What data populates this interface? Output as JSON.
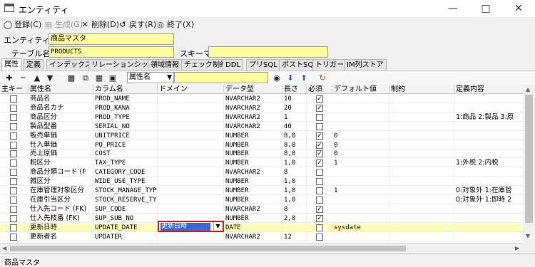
{
  "window": {
    "title": "エンティティ"
  },
  "toolbar": {
    "register": "登録(C)",
    "generate": "生成(G)",
    "delete": "削除(D)",
    "back": "戻す(R)",
    "exit": "終了(X)"
  },
  "entity": {
    "name_label": "エンティティ名",
    "name_value": "商品マスタ",
    "table_label": "テーブル名",
    "table_value": "PRODUCTS",
    "schema_label": "スキーマ",
    "schema_value": ""
  },
  "tabs": [
    "属性",
    "定義",
    "インデックス",
    "リレーションシップ",
    "領域情報",
    "チェック制約",
    "DDL",
    "プリSQL",
    "ポストSQL",
    "トリガー",
    "IM列ストア"
  ],
  "grid_toolbar": {
    "combo_value": "属性名"
  },
  "grid": {
    "columns": [
      "主キー",
      "属性名",
      "カラム名",
      "ドメイン",
      "データ型",
      "長さ",
      "必須",
      "デフォルト値",
      "制約",
      "定義内容"
    ],
    "rows": [
      {
        "pk": false,
        "attr": "商品名",
        "col": "PROD_NAME",
        "domain": "",
        "type": "NVARCHAR2",
        "len": "10",
        "req": true,
        "def": "",
        "chk": "",
        "desc": ""
      },
      {
        "pk": false,
        "attr": "商品名カナ",
        "col": "PROD_KANA",
        "domain": "",
        "type": "NVARCHAR2",
        "len": "20",
        "req": true,
        "def": "",
        "chk": "",
        "desc": ""
      },
      {
        "pk": false,
        "attr": "商品区分",
        "col": "PROD_TYPE",
        "domain": "",
        "type": "NVARCHAR2",
        "len": "1",
        "req": false,
        "def": "",
        "chk": "",
        "desc": "1:商品 2:製品 3:原"
      },
      {
        "pk": false,
        "attr": "製品型番",
        "col": "SERIAL_NO",
        "domain": "",
        "type": "NVARCHAR2",
        "len": "40",
        "req": false,
        "def": "",
        "chk": "",
        "desc": ""
      },
      {
        "pk": false,
        "attr": "販売単価",
        "col": "UNITPRICE",
        "domain": "",
        "type": "NUMBER",
        "len": "8,0",
        "req": true,
        "def": "0",
        "chk": "",
        "desc": ""
      },
      {
        "pk": false,
        "attr": "仕入単価",
        "col": "PO_PRICE",
        "domain": "",
        "type": "NUMBER",
        "len": "8,0",
        "req": true,
        "def": "0",
        "chk": "",
        "desc": ""
      },
      {
        "pk": false,
        "attr": "売上原価",
        "col": "COST",
        "domain": "",
        "type": "NUMBER",
        "len": "8,0",
        "req": true,
        "def": "0",
        "chk": "",
        "desc": ""
      },
      {
        "pk": false,
        "attr": "税区分",
        "col": "TAX_TYPE",
        "domain": "",
        "type": "NUMBER",
        "len": "1,0",
        "req": true,
        "def": "1",
        "chk": "",
        "desc": "1:外税 2:内税"
      },
      {
        "pk": false,
        "attr": "商品分類コード (F",
        "col": "CATEGORY_CODE",
        "domain": "",
        "type": "NVARCHAR2",
        "len": "8",
        "req": false,
        "def": "",
        "chk": "",
        "desc": ""
      },
      {
        "pk": false,
        "attr": "雑区分",
        "col": "WIDE_USE_TYPE",
        "domain": "",
        "type": "NUMBER",
        "len": "1,0",
        "req": false,
        "def": "",
        "chk": "",
        "desc": ""
      },
      {
        "pk": false,
        "attr": "在庫管理対象区分",
        "col": "STOCK_MANAGE_TYPE",
        "domain": "",
        "type": "NUMBER",
        "len": "1,0",
        "req": false,
        "def": "1",
        "chk": "",
        "desc": "0:対象外 1:在庫管"
      },
      {
        "pk": false,
        "attr": "在庫引当区分",
        "col": "STOCK_RESERVE_TYP",
        "domain": "",
        "type": "NUMBER",
        "len": "1,0",
        "req": false,
        "def": "",
        "chk": "",
        "desc": "0:対象外 1:即時 2"
      },
      {
        "pk": false,
        "attr": "仕入先コード (FK)",
        "col": "SUP_CODE",
        "domain": "",
        "type": "NVARCHAR2",
        "len": "8",
        "req": true,
        "def": "",
        "chk": "",
        "desc": ""
      },
      {
        "pk": false,
        "attr": "仕入先枝番 (FK)",
        "col": "SUP_SUB_NO",
        "domain": "",
        "type": "NUMBER",
        "len": "2,0",
        "req": true,
        "def": "",
        "chk": "",
        "desc": ""
      },
      {
        "pk": false,
        "attr": "更新日時",
        "col": "UPDATE_DATE",
        "domain": "更新日時",
        "type": "DATE",
        "len": "",
        "req": false,
        "def": "sysdate",
        "chk": "",
        "desc": "",
        "selected": true
      },
      {
        "pk": false,
        "attr": "更新者名",
        "col": "UPDATER",
        "domain": "",
        "type": "NVARCHAR2",
        "len": "12",
        "req": false,
        "def": "",
        "chk": "",
        "desc": ""
      }
    ]
  },
  "status": {
    "text": "商品マスタ"
  }
}
